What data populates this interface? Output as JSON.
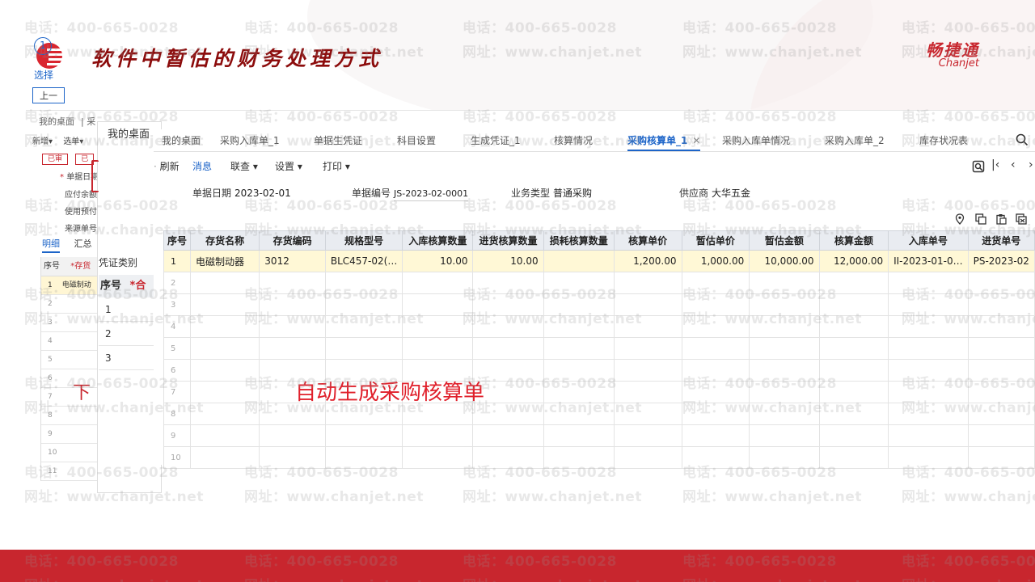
{
  "slide": {
    "title": "软件中暂估的财务处理方式",
    "brand_cn": "畅捷通",
    "brand_en": "Chanjet",
    "caption": "自动生成采购核算单",
    "watermark_phone": "电话：400-665-0028",
    "watermark_site": "网址：www.chanjet.net",
    "accent_color": "#c8262e"
  },
  "background_window": {
    "breadcrumb": [
      "我的桌面",
      "采"
    ],
    "toolbar": [
      "新增",
      "选单"
    ],
    "status_badges": [
      "已审",
      "已"
    ],
    "fields": [
      "单据日期",
      "应付余额",
      "使用预付",
      "来源单号"
    ],
    "tabs": [
      "明细",
      "汇总"
    ],
    "table_headers": [
      "序号",
      "*存货"
    ],
    "rows": [
      {
        "idx": "1",
        "name": "电磁制动"
      },
      {
        "idx": "2",
        "name": ""
      },
      {
        "idx": "3",
        "name": ""
      },
      {
        "idx": "4",
        "name": ""
      },
      {
        "idx": "5",
        "name": ""
      },
      {
        "idx": "6",
        "name": ""
      },
      {
        "idx": "7",
        "name": ""
      },
      {
        "idx": "8",
        "name": ""
      },
      {
        "idx": "9",
        "name": ""
      },
      {
        "idx": "10",
        "name": ""
      },
      {
        "idx": "11",
        "name": ""
      }
    ],
    "partial_caption": "下"
  },
  "dialog": {
    "title": "我的桌面",
    "step": "1",
    "select_label": "选择",
    "prev_button": "上一",
    "voucher_type": "凭证类别",
    "table_headers": [
      "序号",
      "*合"
    ],
    "rows": [
      "1",
      "2",
      "3"
    ]
  },
  "main": {
    "tabs": [
      {
        "label": "我的桌面",
        "active": false
      },
      {
        "label": "采购入库单_1",
        "active": false
      },
      {
        "label": "单据生凭证",
        "active": false
      },
      {
        "label": "科目设置",
        "active": false
      },
      {
        "label": "生成凭证_1",
        "active": false
      },
      {
        "label": "核算情况",
        "active": false
      },
      {
        "label": "采购核算单_1",
        "active": true
      },
      {
        "label": "采购入库单情况",
        "active": false
      },
      {
        "label": "采购入库单_2",
        "active": false
      },
      {
        "label": "库存状况表",
        "active": false
      }
    ],
    "toolbar": {
      "refresh": "刷新",
      "message": "消息",
      "link": "联查",
      "settings": "设置",
      "print": "打印"
    },
    "form": {
      "date_label": "单据日期",
      "date_value": "2023-02-01",
      "number_label": "单据编号",
      "number_value": "JS-2023-02-0001",
      "biz_type_label": "业务类型",
      "biz_type_value": "普通采购",
      "supplier_label": "供应商",
      "supplier_value": "大华五金"
    },
    "table": {
      "headers": [
        "序号",
        "存货名称",
        "存货编码",
        "规格型号",
        "入库核算数量",
        "进货核算数量",
        "损耗核算数量",
        "核算单价",
        "暂估单价",
        "暂估金额",
        "核算金额",
        "入库单号",
        "进货单号"
      ],
      "rows": [
        [
          "1",
          "电磁制动器",
          "3012",
          "BLC457-02(…",
          "10.00",
          "10.00",
          "",
          "1,200.00",
          "1,000.00",
          "10,000.00",
          "12,000.00",
          "II-2023-01-0…",
          "PS-2023-02"
        ],
        [
          "2",
          "",
          "",
          "",
          "",
          "",
          "",
          "",
          "",
          "",
          "",
          "",
          ""
        ],
        [
          "3",
          "",
          "",
          "",
          "",
          "",
          "",
          "",
          "",
          "",
          "",
          "",
          ""
        ],
        [
          "4",
          "",
          "",
          "",
          "",
          "",
          "",
          "",
          "",
          "",
          "",
          "",
          ""
        ],
        [
          "5",
          "",
          "",
          "",
          "",
          "",
          "",
          "",
          "",
          "",
          "",
          "",
          ""
        ],
        [
          "6",
          "",
          "",
          "",
          "",
          "",
          "",
          "",
          "",
          "",
          "",
          "",
          ""
        ],
        [
          "7",
          "",
          "",
          "",
          "",
          "",
          "",
          "",
          "",
          "",
          "",
          "",
          ""
        ],
        [
          "8",
          "",
          "",
          "",
          "",
          "",
          "",
          "",
          "",
          "",
          "",
          "",
          ""
        ],
        [
          "9",
          "",
          "",
          "",
          "",
          "",
          "",
          "",
          "",
          "",
          "",
          "",
          ""
        ],
        [
          "10",
          "",
          "",
          "",
          "",
          "",
          "",
          "",
          "",
          "",
          "",
          "",
          ""
        ]
      ]
    }
  }
}
